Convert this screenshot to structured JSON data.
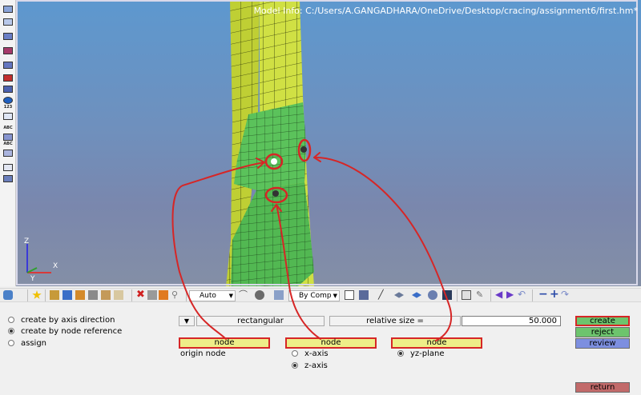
{
  "model_info": "Model Info: C:/Users/A.GANGADHARA/OneDrive/Desktop/cracing/assignment6/first.hm*",
  "left_toolbar": {
    "label_123": "123",
    "label_abc_1": "ABC",
    "label_abc_2": "ABC"
  },
  "triad": {
    "x": "X",
    "y": "Y",
    "z": "Z"
  },
  "toolbar": {
    "auto_select": "Auto",
    "by_comp_select": "By Comp"
  },
  "panel": {
    "radio_axis_direction": "create by axis direction",
    "radio_node_reference": "create by node reference",
    "radio_assign": "assign",
    "selected_radio": "create by node reference",
    "system_type": "rectangular",
    "relative_size_label": "relative size =",
    "relative_size_value": "50.000",
    "node1_label": "node",
    "node1_caption": "origin node",
    "node2_label": "node",
    "node2_option_x": "x-axis",
    "node2_option_z": "z-axis",
    "node2_selected": "z-axis",
    "node3_label": "node",
    "node3_option": "yz-plane",
    "btn_create": "create",
    "btn_reject": "reject",
    "btn_review": "review",
    "btn_return": "return"
  },
  "colors": {
    "viewport_top": "#5d98cf",
    "viewport_bottom": "#848fa6",
    "mesh_green": "#58c058",
    "mesh_yellow": "#c8d83a",
    "annotation_red": "#d62626",
    "create_green": "#6dc46d",
    "review_blue": "#7d8fe0",
    "return_red": "#c26a6a",
    "node_yellow": "#eeee88"
  }
}
